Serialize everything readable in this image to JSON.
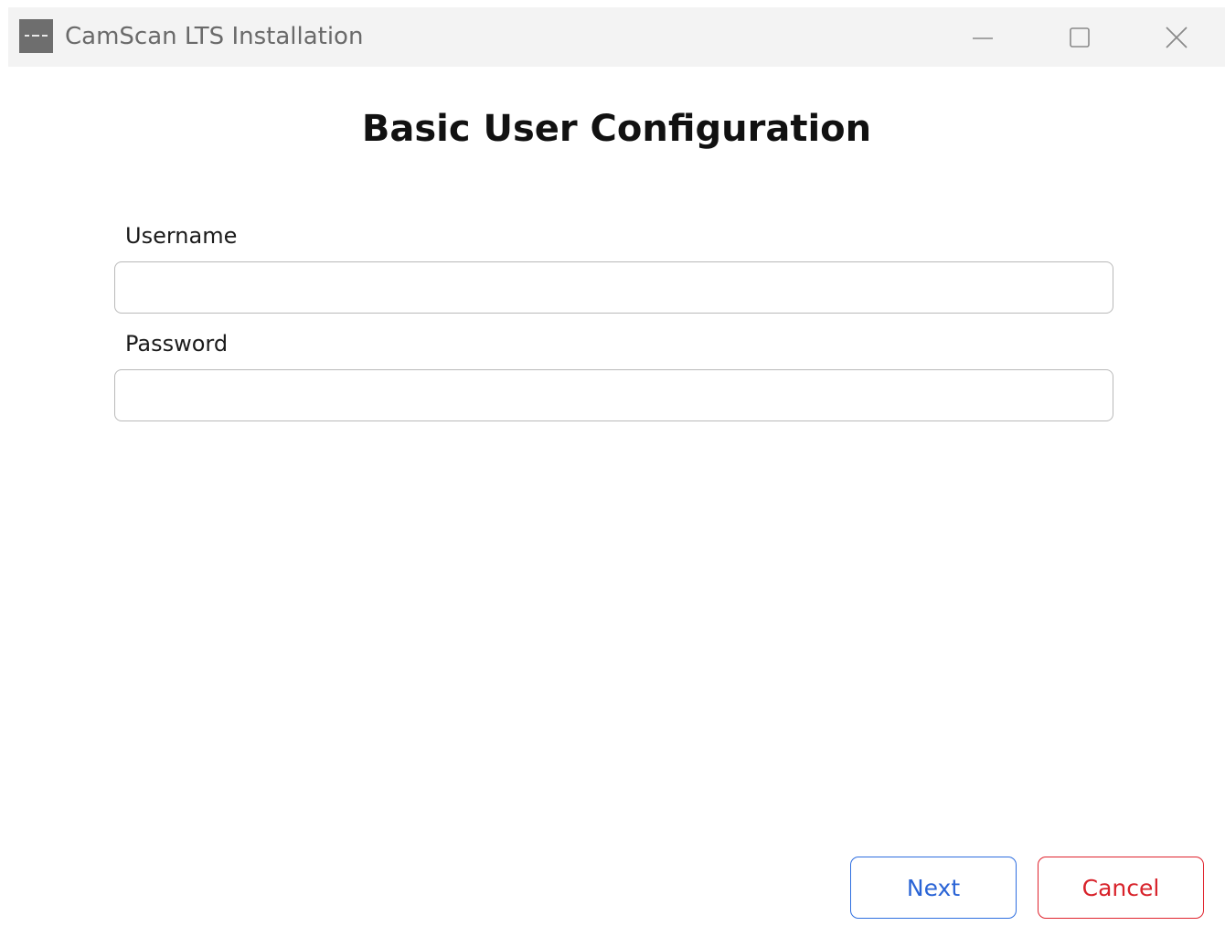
{
  "window": {
    "title": "CamScan LTS Installation",
    "controls": {
      "minimize_icon": "minimize-icon",
      "maximize_icon": "maximize-icon",
      "close_icon": "close-icon"
    }
  },
  "page": {
    "heading": "Basic User Configuration"
  },
  "form": {
    "username": {
      "label": "Username",
      "value": "",
      "placeholder": ""
    },
    "password": {
      "label": "Password",
      "value": "",
      "placeholder": ""
    }
  },
  "actions": {
    "next_label": "Next",
    "cancel_label": "Cancel"
  },
  "colors": {
    "next_accent": "#2f6fe0",
    "cancel_accent": "#e0242e",
    "titlebar_bg": "#f3f3f3"
  }
}
